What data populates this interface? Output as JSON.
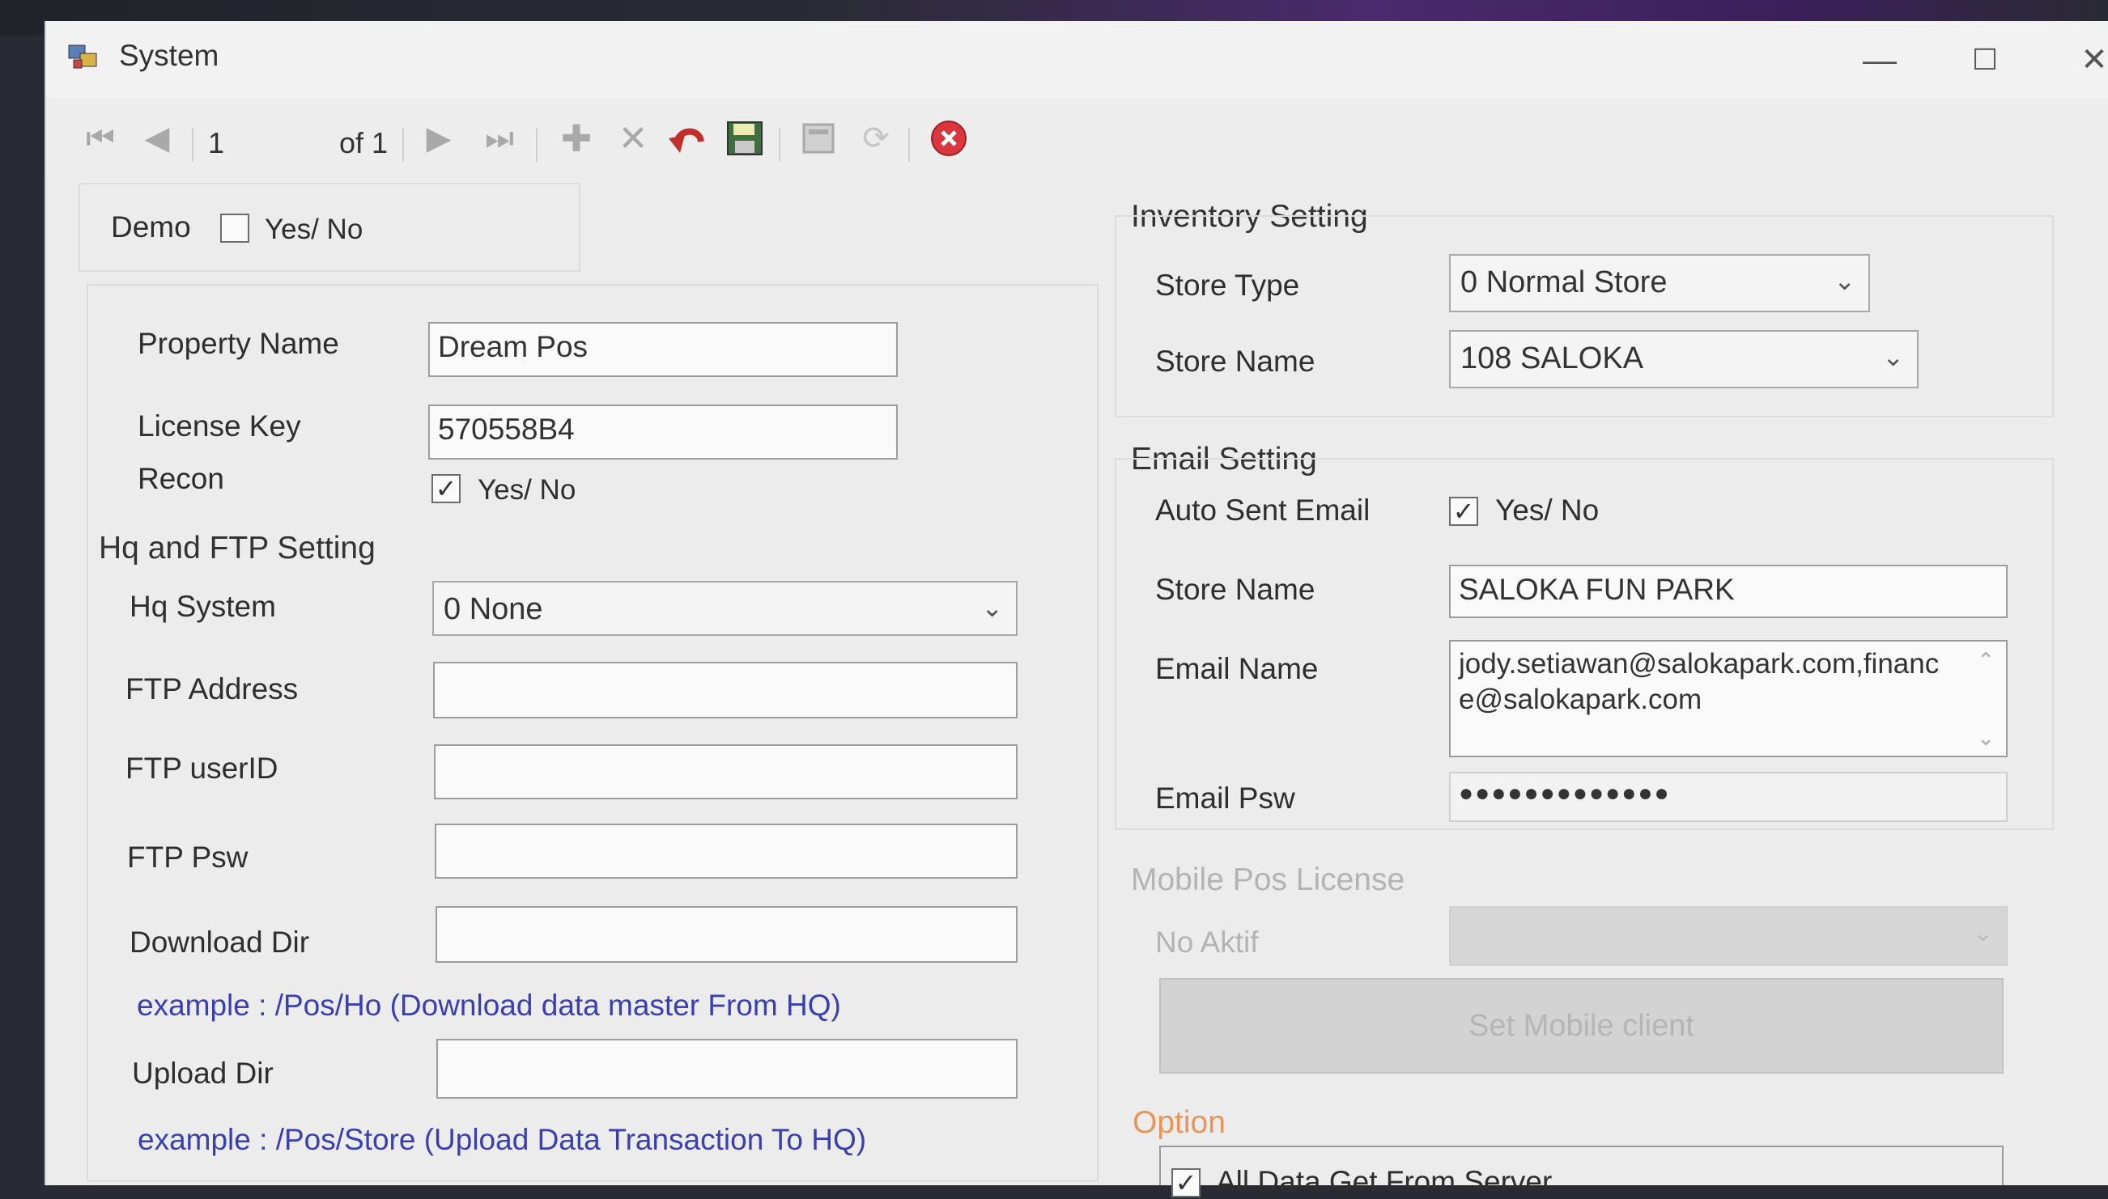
{
  "window": {
    "title": "System",
    "controls": {
      "minimize": "—",
      "maximize": "☐",
      "close": "✕"
    }
  },
  "toolbar": {
    "position": "1",
    "of_label": "of 1"
  },
  "demo": {
    "label": "Demo",
    "checkbox_label": "Yes/ No",
    "checked": false
  },
  "property_name": {
    "label": "Property Name",
    "value": "Dream Pos"
  },
  "license_key": {
    "label": "License Key",
    "value": "570558B4"
  },
  "recon": {
    "label": "Recon",
    "checkbox_label": "Yes/ No",
    "checked": true
  },
  "hq_ftp": {
    "section_title": "Hq and FTP Setting",
    "hq_system": {
      "label": "Hq System",
      "value": "0 None"
    },
    "ftp_address": {
      "label": "FTP Address",
      "value": ""
    },
    "ftp_userid": {
      "label": "FTP userID",
      "value": ""
    },
    "ftp_psw": {
      "label": "FTP Psw",
      "value": ""
    },
    "download_dir": {
      "label": "Download Dir",
      "value": ""
    },
    "download_example": "example :  /Pos/Ho (Download data master From HQ)",
    "upload_dir": {
      "label": "Upload Dir",
      "value": ""
    },
    "upload_example": "example :  /Pos/Store (Upload Data Transaction To HQ)"
  },
  "inventory": {
    "section_title": "Inventory Setting",
    "store_type": {
      "label": "Store Type",
      "value": "0 Normal Store"
    },
    "store_name": {
      "label": "Store Name",
      "value": "108  SALOKA"
    }
  },
  "email": {
    "section_title": "Email Setting",
    "auto_sent": {
      "label": "Auto Sent Email",
      "checkbox_label": "Yes/ No",
      "checked": true
    },
    "store_name": {
      "label": "Store Name",
      "value": "SALOKA FUN PARK"
    },
    "email_name": {
      "label": "Email Name",
      "line1": "jody.setiawan@salokapark.com,financ",
      "line2": "e@salokapark.com"
    },
    "email_psw": {
      "label": "Email Psw",
      "value": "●●●●●●●●●●●●●"
    }
  },
  "mobile": {
    "section_title": "Mobile Pos License",
    "status_label": "No Aktif",
    "button_label": "Set Mobile client"
  },
  "option": {
    "section_title": "Option",
    "all_data": {
      "label": "All Data Get From Server",
      "checked": true
    }
  },
  "colors": {
    "example_text": "#3a3fb0",
    "option_title": "#e8955a",
    "stop_icon": "#d9363e"
  }
}
